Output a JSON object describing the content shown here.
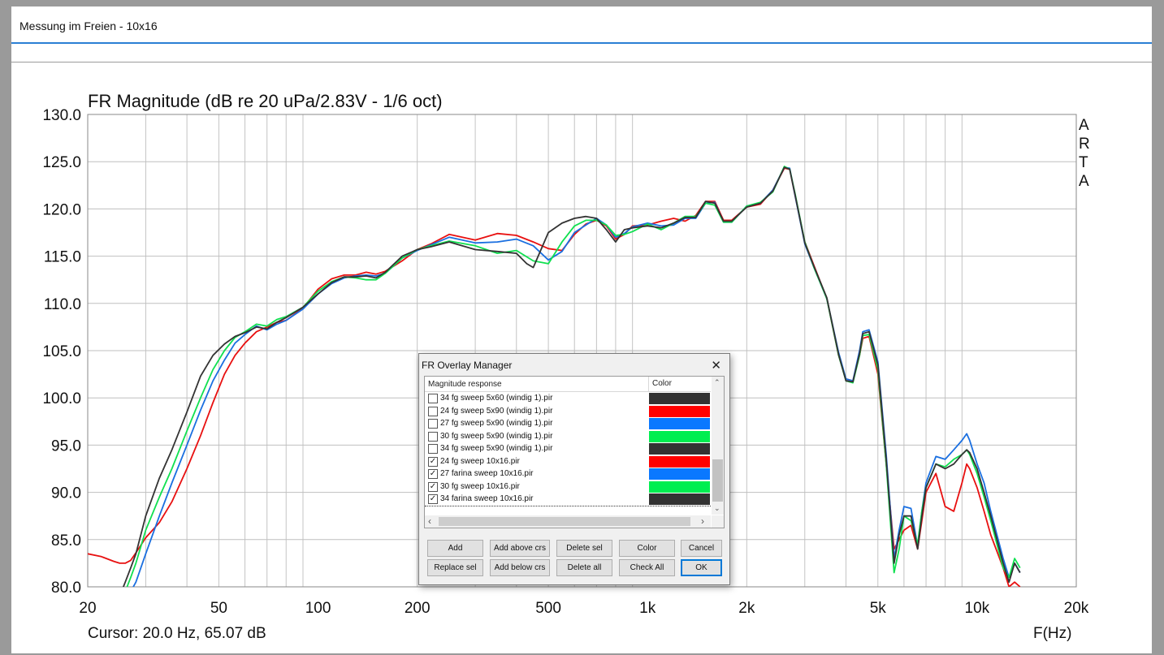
{
  "window": {
    "title": "Messung im Freien - 10x16"
  },
  "chart_data": {
    "type": "line",
    "title": "FR Magnitude (dB re 20 uPa/2.83V - 1/6 oct)",
    "xlabel": "F(Hz)",
    "ylabel": "",
    "watermark": [
      "A",
      "R",
      "T",
      "A"
    ],
    "x_scale": "log",
    "xlim": [
      20,
      20000
    ],
    "ylim": [
      80,
      130
    ],
    "x_ticks": [
      {
        "value": 20,
        "label": "20"
      },
      {
        "value": 50,
        "label": "50"
      },
      {
        "value": 100,
        "label": "100"
      },
      {
        "value": 200,
        "label": "200"
      },
      {
        "value": 500,
        "label": "500"
      },
      {
        "value": 1000,
        "label": "1k"
      },
      {
        "value": 2000,
        "label": "2k"
      },
      {
        "value": 5000,
        "label": "5k"
      },
      {
        "value": 10000,
        "label": "10k"
      },
      {
        "value": 20000,
        "label": "20k"
      }
    ],
    "y_ticks": [
      "130.0",
      "125.0",
      "120.0",
      "115.0",
      "110.0",
      "105.0",
      "100.0",
      "95.0",
      "90.0",
      "85.0",
      "80.0"
    ],
    "grid": true,
    "cursor": "Cursor: 20.0 Hz, 65.07 dB",
    "series": [
      {
        "name": "24 fg sweep 10x16.pir",
        "color": "#e81010",
        "x": [
          20,
          22,
          24,
          25,
          26,
          27,
          28,
          30,
          33,
          36,
          40,
          44,
          48,
          52,
          56,
          60,
          65,
          70,
          75,
          80,
          90,
          100,
          110,
          120,
          130,
          140,
          150,
          160,
          180,
          200,
          220,
          250,
          300,
          350,
          400,
          450,
          500,
          550,
          600,
          650,
          700,
          750,
          800,
          850,
          900,
          1000,
          1100,
          1200,
          1300,
          1400,
          1500,
          1600,
          1700,
          1800,
          2000,
          2200,
          2400,
          2600,
          2700,
          2800,
          3000,
          3200,
          3500,
          3800,
          4000,
          4200,
          4400,
          4500,
          4700,
          5000,
          5300,
          5600,
          5800,
          6000,
          6300,
          6600,
          6800,
          7000,
          7500,
          8000,
          8500,
          9000,
          9300,
          9500,
          10000,
          10500,
          11000,
          12000,
          12500,
          13000,
          13500
        ],
        "y": [
          83.5,
          83.2,
          82.7,
          82.5,
          82.5,
          82.8,
          83.6,
          85.2,
          86.8,
          89,
          92.5,
          96,
          99.5,
          102.5,
          104.5,
          105.8,
          107,
          107.5,
          108,
          108.2,
          109.5,
          111.5,
          112.6,
          113,
          113,
          113.3,
          113.1,
          113.4,
          114.5,
          115.7,
          116.3,
          117.3,
          116.7,
          117.4,
          117.2,
          116.5,
          115.8,
          115.6,
          117.3,
          118.4,
          118.8,
          118.2,
          116.8,
          117.3,
          118.2,
          118.3,
          118.7,
          119,
          118.7,
          119.3,
          120.8,
          120.8,
          118.8,
          118.8,
          120.2,
          120.5,
          122,
          124.3,
          124.2,
          121.5,
          116.5,
          114,
          110.5,
          104.5,
          102,
          101.8,
          104.5,
          106.3,
          106.5,
          102.5,
          93,
          84,
          85,
          86,
          86.5,
          84,
          87,
          90,
          92,
          88.5,
          88,
          91,
          93,
          92.5,
          90.5,
          88,
          85.5,
          82,
          80,
          80.5,
          80
        ]
      },
      {
        "name": "27 farina sweep 10x16.pir",
        "color": "#1a6fe0",
        "x": [
          20,
          22,
          24,
          25,
          26,
          27,
          28,
          30,
          33,
          36,
          40,
          44,
          48,
          52,
          56,
          60,
          65,
          70,
          75,
          80,
          90,
          100,
          110,
          120,
          130,
          140,
          150,
          160,
          180,
          200,
          220,
          250,
          300,
          350,
          400,
          450,
          500,
          550,
          600,
          650,
          700,
          750,
          800,
          850,
          900,
          1000,
          1100,
          1200,
          1300,
          1400,
          1500,
          1600,
          1700,
          1800,
          2000,
          2200,
          2400,
          2600,
          2700,
          2800,
          3000,
          3200,
          3500,
          3800,
          4000,
          4200,
          4400,
          4500,
          4700,
          5000,
          5300,
          5600,
          5800,
          6000,
          6300,
          6600,
          6800,
          7000,
          7500,
          8000,
          8500,
          9000,
          9300,
          9500,
          10000,
          10500,
          11000,
          12000,
          12500,
          13000,
          13500
        ],
        "y": [
          72,
          74,
          76,
          77.5,
          78.5,
          79.5,
          80.5,
          83.5,
          87.5,
          91,
          95,
          98.7,
          101.8,
          104,
          105.8,
          106.7,
          107.6,
          107.2,
          107.8,
          108.2,
          109.4,
          111,
          112.1,
          112.7,
          112.9,
          113,
          112.9,
          113.2,
          114.8,
          115.6,
          116.2,
          117,
          116.4,
          116.5,
          116.8,
          116.1,
          114.6,
          115.5,
          117.5,
          118.3,
          119,
          118.3,
          117,
          117.4,
          118.1,
          118.5,
          118.2,
          118.3,
          119,
          119,
          120.6,
          120.7,
          118.6,
          118.6,
          120.3,
          120.6,
          122,
          124.4,
          124.3,
          121.5,
          116.3,
          113.8,
          110.5,
          104.8,
          102,
          101.8,
          105,
          107,
          107.2,
          103.8,
          94,
          83,
          86,
          88.5,
          88.3,
          84.3,
          88,
          91,
          93.8,
          93.5,
          94.5,
          95.5,
          96.2,
          95.5,
          93,
          91,
          88,
          83,
          81,
          82.5,
          81.5
        ]
      },
      {
        "name": "30 fg sweep 10x16.pir",
        "color": "#10e050",
        "x": [
          20,
          22,
          24,
          25,
          26,
          27,
          28,
          30,
          33,
          36,
          40,
          44,
          48,
          52,
          56,
          60,
          65,
          70,
          75,
          80,
          90,
          100,
          110,
          120,
          130,
          140,
          150,
          160,
          180,
          200,
          220,
          250,
          300,
          350,
          400,
          450,
          500,
          550,
          600,
          650,
          700,
          750,
          800,
          850,
          900,
          1000,
          1100,
          1200,
          1300,
          1400,
          1500,
          1600,
          1700,
          1800,
          2000,
          2200,
          2400,
          2600,
          2700,
          2800,
          3000,
          3200,
          3500,
          3800,
          4000,
          4200,
          4400,
          4500,
          4700,
          5000,
          5300,
          5600,
          5800,
          6000,
          6300,
          6600,
          6800,
          7000,
          7500,
          8000,
          8500,
          9000,
          9300,
          9500,
          10000,
          10500,
          11000,
          12000,
          12500,
          13000,
          13500
        ],
        "y": [
          72,
          74.5,
          77,
          78.5,
          79.5,
          81,
          82.5,
          86,
          89.5,
          92.5,
          96.5,
          100,
          103,
          105,
          106.4,
          107,
          107.8,
          107.6,
          108.3,
          108.6,
          109.6,
          111.3,
          112.3,
          112.8,
          112.7,
          112.5,
          112.5,
          113.2,
          114.8,
          115.7,
          116.1,
          116.6,
          116.1,
          115.3,
          115.6,
          114.5,
          114.2,
          116.5,
          118.2,
          118.8,
          118.8,
          118.3,
          117.2,
          117.3,
          117.6,
          118.4,
          117.8,
          118.5,
          119.2,
          119.2,
          120.6,
          120.4,
          118.6,
          118.6,
          120.3,
          120.7,
          121.8,
          124.5,
          124.2,
          121.7,
          116.5,
          113.8,
          110.5,
          104.5,
          101.8,
          101.6,
          104.5,
          106.6,
          106.7,
          103,
          93,
          81.5,
          84,
          87.5,
          87,
          84.5,
          88,
          90.5,
          93,
          92.7,
          93.5,
          94,
          94.5,
          94,
          92,
          89.5,
          87,
          82,
          81,
          83,
          82
        ]
      },
      {
        "name": "34 farina sweep 10x16.pir",
        "color": "#333333",
        "x": [
          20,
          22,
          24,
          25,
          26,
          27,
          28,
          30,
          33,
          36,
          40,
          44,
          48,
          52,
          56,
          60,
          65,
          70,
          75,
          80,
          90,
          100,
          110,
          120,
          130,
          140,
          150,
          160,
          180,
          200,
          220,
          250,
          300,
          350,
          400,
          430,
          450,
          500,
          550,
          600,
          650,
          700,
          750,
          800,
          850,
          900,
          1000,
          1100,
          1200,
          1300,
          1400,
          1500,
          1600,
          1700,
          1800,
          2000,
          2200,
          2400,
          2600,
          2700,
          2800,
          3000,
          3200,
          3500,
          3800,
          4000,
          4200,
          4400,
          4500,
          4700,
          5000,
          5300,
          5600,
          5800,
          6000,
          6300,
          6600,
          6800,
          7000,
          7500,
          8000,
          8500,
          9000,
          9300,
          9500,
          10000,
          10500,
          11000,
          12000,
          12500,
          13000,
          13500
        ],
        "y": [
          72,
          74.5,
          77.5,
          79,
          80.5,
          82,
          83.5,
          87.5,
          91.5,
          94.5,
          98.5,
          102.3,
          104.5,
          105.7,
          106.5,
          106.9,
          107.5,
          107.3,
          108,
          108.5,
          109.6,
          111,
          112.2,
          112.8,
          112.8,
          112.9,
          112.7,
          113.3,
          115,
          115.7,
          116,
          116.5,
          115.7,
          115.5,
          115.3,
          114.2,
          113.8,
          117.5,
          118.5,
          119,
          119.2,
          119,
          117.8,
          116.5,
          117.8,
          118,
          118.2,
          118,
          118.5,
          119.1,
          119.1,
          120.8,
          120.6,
          118.7,
          118.7,
          120.2,
          120.6,
          121.9,
          124.4,
          124.2,
          121.6,
          116.4,
          113.9,
          110.6,
          104.6,
          101.8,
          101.7,
          104.7,
          106.8,
          107,
          103.5,
          93.5,
          82.5,
          85.5,
          87.5,
          87.5,
          84,
          87.5,
          90.5,
          93,
          92.5,
          93,
          94,
          94.5,
          94.2,
          92.5,
          90,
          87.5,
          82.5,
          80.5,
          82.5,
          81.5
        ]
      }
    ]
  },
  "dialog": {
    "title": "FR Overlay Manager",
    "close_glyph": "✕",
    "col_response": "Magnitude response",
    "col_color": "Color",
    "rows": [
      {
        "label": "34 fg sweep 5x60 (windig 1).pir",
        "checked": false,
        "color": "#333333"
      },
      {
        "label": "24 fg sweep 5x90 (windig 1).pir",
        "checked": false,
        "color": "#ff0000"
      },
      {
        "label": "27 fg sweep 5x90 (windig 1).pir",
        "checked": false,
        "color": "#0a78ff"
      },
      {
        "label": "30 fg sweep 5x90 (windig 1).pir",
        "checked": false,
        "color": "#00ee50"
      },
      {
        "label": "34 fg sweep 5x90 (windig 1).pir",
        "checked": false,
        "color": "#333333"
      },
      {
        "label": "24 fg sweep 10x16.pir",
        "checked": true,
        "color": "#ff0000"
      },
      {
        "label": "27 farina sweep 10x16.pir",
        "checked": true,
        "color": "#0a78ff"
      },
      {
        "label": "30 fg sweep 10x16.pir",
        "checked": true,
        "color": "#00ee50"
      },
      {
        "label": "34 farina sweep 10x16.pir",
        "checked": true,
        "color": "#333333"
      }
    ],
    "check_glyph": "✓",
    "scroll": {
      "up": "⌃",
      "down": "⌄",
      "left": "‹",
      "right": "›"
    },
    "buttons": {
      "add": "Add",
      "add_above": "Add above crs",
      "delete_sel": "Delete sel",
      "color": "Color",
      "cancel": "Cancel",
      "replace_sel": "Replace sel",
      "add_below": "Add below crs",
      "delete_all": "Delete all",
      "check_all": "Check All",
      "ok": "OK"
    }
  }
}
